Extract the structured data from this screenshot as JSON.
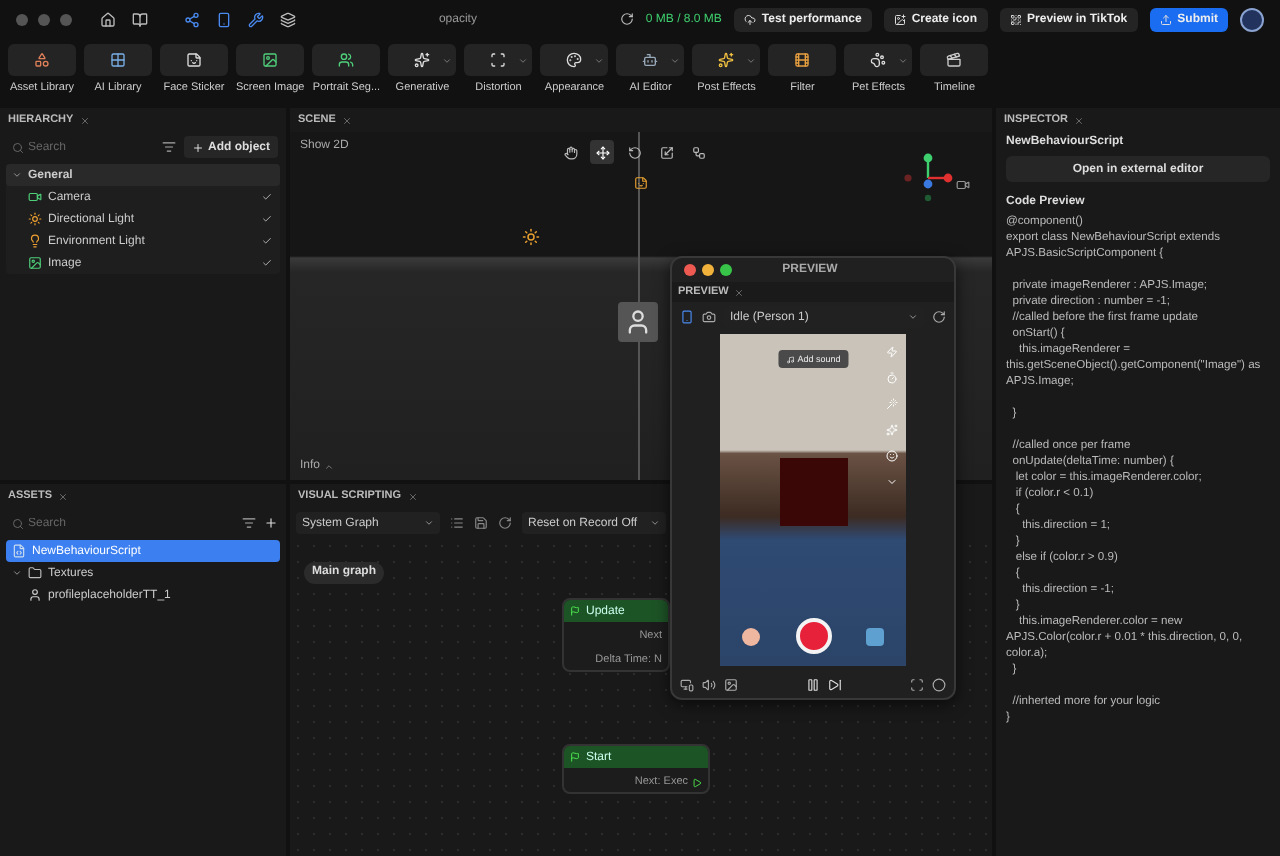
{
  "window": {
    "title": "opacity"
  },
  "top_bar": {
    "memory": "0 MB / 8.0 MB",
    "buttons": [
      {
        "label": "Test performance",
        "kind": "cloud"
      },
      {
        "label": "Create icon",
        "kind": "icon"
      },
      {
        "label": "Preview in TikTok",
        "kind": "preview"
      },
      {
        "label": "Submit",
        "kind": "primary"
      }
    ]
  },
  "tools": [
    {
      "label": "Asset Library",
      "dropdown": false
    },
    {
      "label": "AI Library",
      "dropdown": false
    },
    {
      "label": "Face Sticker",
      "dropdown": false
    },
    {
      "label": "Screen Image",
      "dropdown": false
    },
    {
      "label": "Portrait Seg...",
      "dropdown": false
    },
    {
      "label": "Generative",
      "dropdown": true
    },
    {
      "label": "Distortion",
      "dropdown": true
    },
    {
      "label": "Appearance",
      "dropdown": true
    },
    {
      "label": "AI Editor",
      "dropdown": true
    },
    {
      "label": "Post Effects",
      "dropdown": true
    },
    {
      "label": "Filter",
      "dropdown": false
    },
    {
      "label": "Pet Effects",
      "dropdown": true
    },
    {
      "label": "Timeline",
      "dropdown": false
    }
  ],
  "hierarchy": {
    "title": "HIERARCHY",
    "search_placeholder": "Search",
    "add_button": "Add object",
    "tree": [
      {
        "label": "General",
        "kind": "group",
        "expanded": true,
        "children": [
          {
            "label": "Camera",
            "kind": "camera",
            "visible": true
          },
          {
            "label": "Directional Light",
            "kind": "light",
            "visible": true
          },
          {
            "label": "Environment Light",
            "kind": "env-light",
            "visible": true
          },
          {
            "label": "Image",
            "kind": "image",
            "visible": true
          }
        ]
      }
    ]
  },
  "assets": {
    "title": "ASSETS",
    "search_placeholder": "Search",
    "items": [
      {
        "label": "NewBehaviourScript",
        "kind": "script",
        "selected": true
      },
      {
        "label": "Textures",
        "kind": "folder",
        "selected": false,
        "expanded": true,
        "children": [
          {
            "label": "profileplaceholderTT_1",
            "kind": "texture",
            "selected": false
          }
        ]
      }
    ]
  },
  "scene": {
    "title": "SCENE",
    "show_2d": "Show 2D",
    "info": "Info",
    "tools": [
      {
        "kind": "hand",
        "selected": false
      },
      {
        "kind": "move",
        "selected": true
      },
      {
        "kind": "rotate",
        "selected": false
      },
      {
        "kind": "scale",
        "selected": false
      },
      {
        "kind": "transform",
        "selected": false
      }
    ]
  },
  "visual_scripting": {
    "title": "VISUAL SCRIPTING",
    "graph_select": "System Graph",
    "record_select": "Reset on Record Off",
    "graph_tab": "Main graph",
    "nodes": [
      {
        "title": "Update",
        "ports": [
          "Next",
          "Delta Time: N"
        ]
      },
      {
        "title": "Start",
        "ports": [
          "Next: Exec"
        ]
      }
    ]
  },
  "inspector": {
    "title": "INSPECTOR",
    "object": "NewBehaviourScript",
    "editor_button": "Open in external editor",
    "code_title": "Code Preview",
    "code_blocks": [
      [
        "@component()",
        "export class NewBehaviourScript extends APJS.BasicScriptComponent {"
      ],
      [
        "  private imageRenderer : APJS.Image;",
        "  private direction : number = -1;",
        "  //called before the first frame update",
        "  onStart() {",
        "    this.imageRenderer = this.getSceneObject().getComponent(\"Image\") as APJS.Image;"
      ],
      [
        "  }"
      ],
      [
        "  //called once per frame",
        "  onUpdate(deltaTime: number) {",
        "   let color = this.imageRenderer.color;",
        "   if (color.r < 0.1)",
        "   {",
        "     this.direction = 1;",
        "   }",
        "   else if (color.r > 0.9)",
        "   {",
        "     this.direction = -1;",
        "   }",
        "    this.imageRenderer.color = new APJS.Color(color.r + 0.01 * this.direction, 0, 0, color.a);",
        "  }"
      ],
      [
        "  //inherted more for your logic",
        "}"
      ]
    ]
  },
  "preview": {
    "window_title": "PREVIEW",
    "tab": "PREVIEW",
    "state_select": "Idle (Person 1)",
    "add_sound": "Add sound"
  }
}
